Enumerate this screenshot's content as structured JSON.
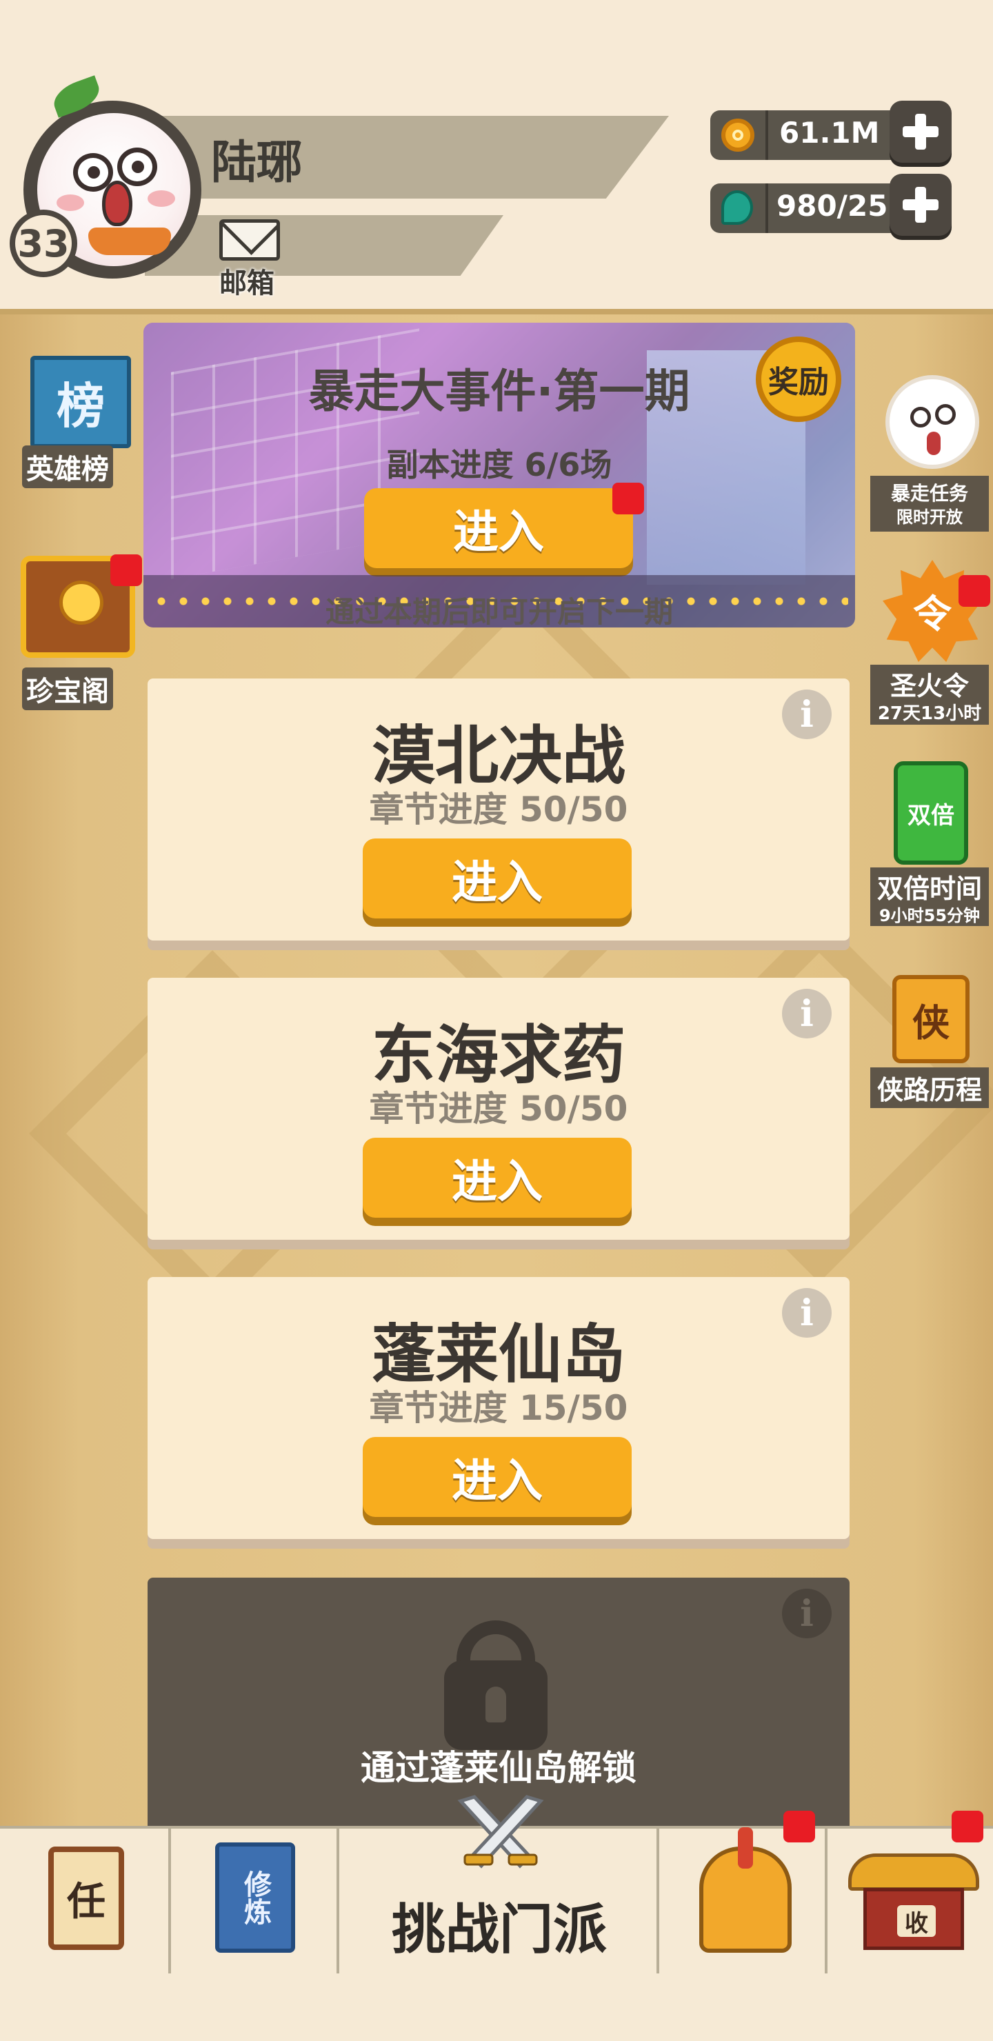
{
  "player": {
    "name": "陆琊",
    "level": "33",
    "mail_label": "邮箱"
  },
  "resources": {
    "coins": {
      "value": "61.1M",
      "icon": "coin-icon"
    },
    "gems": {
      "value": "980/25",
      "icon": "gem-icon"
    }
  },
  "side_left": [
    {
      "label": "英雄榜",
      "glyph": "榜"
    },
    {
      "label": "珍宝阁"
    }
  ],
  "side_right": [
    {
      "label": "暴走任务",
      "sub": "限时开放"
    },
    {
      "label": "圣火令",
      "sub": "27天13小时",
      "glyph": "令"
    },
    {
      "label": "双倍时间",
      "sub": "9小时55分钟",
      "glyph": "双倍"
    },
    {
      "label": "侠路历程",
      "glyph": "侠"
    }
  ],
  "event": {
    "title": "暴走大事件·第一期",
    "reward_label": "奖励",
    "progress": "副本进度 6/6场",
    "enter_label": "进入",
    "note": "通过本期后即可开启下一期"
  },
  "chapters": [
    {
      "title": "漠北决战",
      "progress": "章节进度 50/50",
      "enter_label": "进入"
    },
    {
      "title": "东海求药",
      "progress": "章节进度 50/50",
      "enter_label": "进入"
    },
    {
      "title": "蓬莱仙岛",
      "progress": "章节进度 15/50",
      "enter_label": "进入"
    }
  ],
  "locked_chapter": {
    "text": "通过蓬莱仙岛解锁"
  },
  "info_glyph": "i",
  "bottom_nav": {
    "tasks_glyph": "任",
    "cultivate_glyph": "修炼",
    "challenge_label": "挑战门派",
    "shop_glyph": "收"
  },
  "colors": {
    "accent": "#f8ad1e",
    "badge_red": "#e81c24",
    "card_bg": "#fbecd0"
  }
}
